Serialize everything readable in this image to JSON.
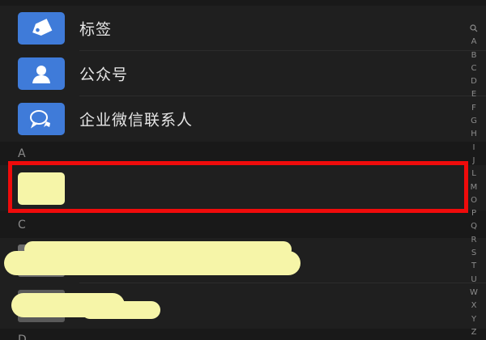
{
  "special_rows": [
    {
      "label": "标签",
      "icon": "tag-icon"
    },
    {
      "label": "公众号",
      "icon": "person-icon"
    },
    {
      "label": "企业微信联系人",
      "icon": "chat-bubbles-icon"
    }
  ],
  "sections": {
    "a": "A",
    "c": "C",
    "d": "D"
  },
  "index_bar": [
    "🔍",
    "A",
    "B",
    "C",
    "D",
    "E",
    "F",
    "G",
    "H",
    "I",
    "J",
    "L",
    "M",
    "O",
    "P",
    "Q",
    "R",
    "S",
    "T",
    "U",
    "W",
    "X",
    "Y",
    "Z",
    "#"
  ],
  "colors": {
    "background": "#191919",
    "icon_blue": "#3f7bd9",
    "highlight_red": "#ef0b0b",
    "redaction_yellow": "#f6f5a8"
  }
}
